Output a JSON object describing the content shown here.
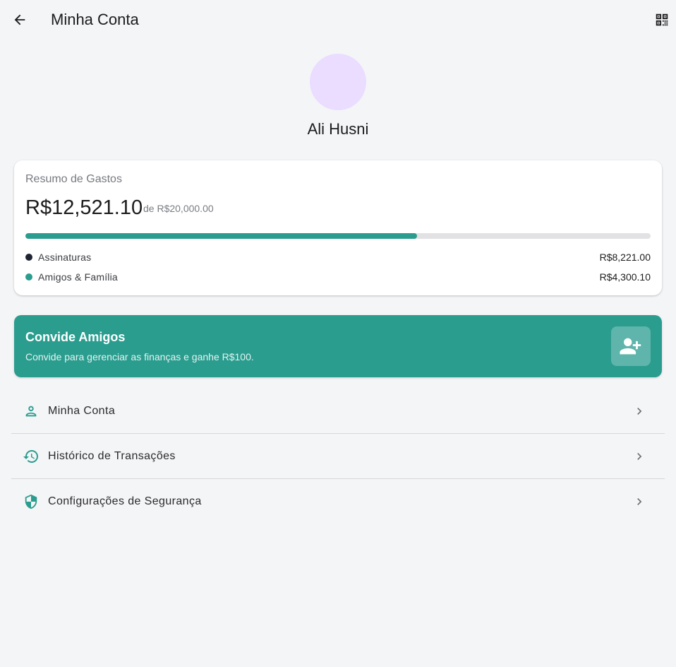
{
  "appbar": {
    "title": "Minha Conta",
    "back_icon": "arrow-left-icon",
    "qr_icon": "qr-scan-icon"
  },
  "profile": {
    "name": "Ali Husni",
    "avatar_color": "#eaddff"
  },
  "spending": {
    "title": "Resumo de Gastos",
    "amount": "R$12,521.10",
    "limit": "de R$20,000.00",
    "progress_fraction": 0.626,
    "items": [
      {
        "label": "Assinaturas",
        "value": "R$8,221.00",
        "color": "#1f2433"
      },
      {
        "label": "Amigos & Família",
        "value": "R$4,300.10",
        "color": "#2a9d8f"
      }
    ]
  },
  "invite": {
    "title": "Convide Amigos",
    "subtitle": "Convide para gerenciar as finanças e ganhe R$100.",
    "icon": "person-add-icon",
    "color": "#2a9d8f"
  },
  "menu": [
    {
      "label": "Minha Conta",
      "icon": "person-icon"
    },
    {
      "label": "Histórico de Transações",
      "icon": "history-icon"
    },
    {
      "label": "Configurações de Segurança",
      "icon": "shield-icon"
    }
  ],
  "colors": {
    "accent": "#2a9d8f",
    "background": "#f4f5f7"
  }
}
